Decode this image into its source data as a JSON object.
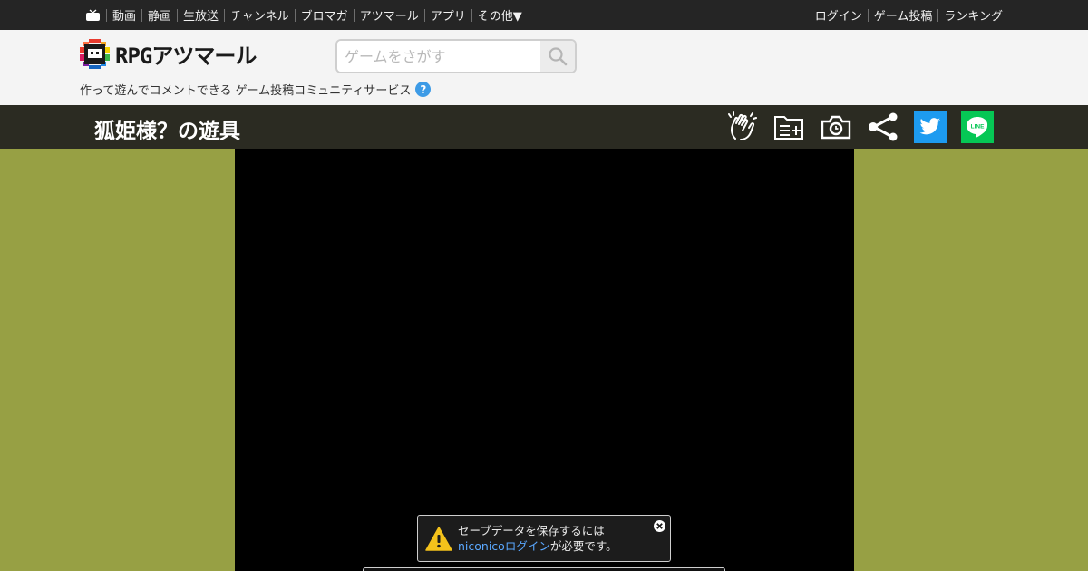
{
  "nicobar": {
    "left_items": [
      "動画",
      "静画",
      "生放送",
      "チャンネル",
      "ブロマガ",
      "アツマール",
      "アプリ",
      "その他▼"
    ],
    "right_items": [
      "ログイン",
      "ゲーム投稿",
      "ランキング"
    ]
  },
  "header": {
    "logo_text": "RPGアツマール",
    "search_placeholder": "ゲームをさがす",
    "tagline": "作って遊んでコメントできる ゲーム投稿コミュニティサービス",
    "help_label": "?"
  },
  "titlebar": {
    "title": "狐姫様？の遊具",
    "icons": [
      "clap-icon",
      "add-to-list-icon",
      "screenshot-icon",
      "share-icon",
      "twitter-icon",
      "line-icon"
    ],
    "line_label": "LINE"
  },
  "notice": {
    "line1": "セーブデータを保存するには",
    "link": "niconicoログイン",
    "line2_suffix": "が必要です。"
  },
  "colors": {
    "background": "#97a044",
    "nicobar": "#252525",
    "titlebar": "#2b2b22",
    "twitter": "#1d9bf0",
    "line": "#06c755",
    "link": "#5aa8ff"
  }
}
